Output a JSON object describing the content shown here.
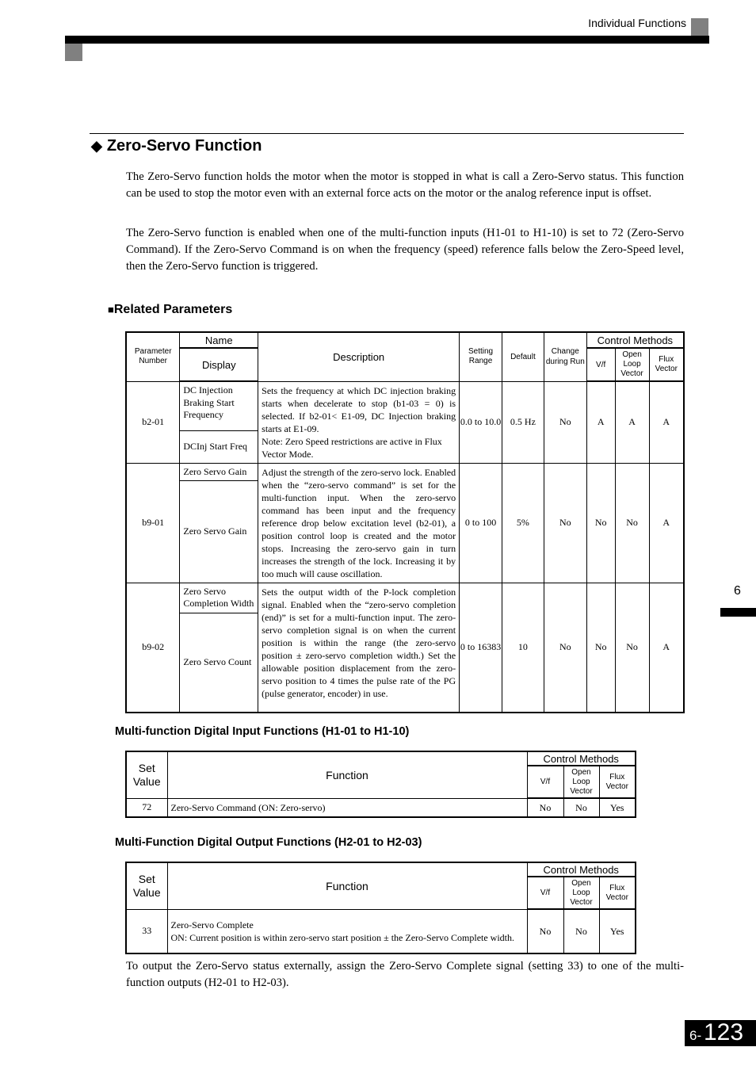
{
  "header": {
    "section": "Individual Functions"
  },
  "section": {
    "icon": "diamond-icon",
    "title": "Zero-Servo Function",
    "paragraphs": [
      "The Zero-Servo function holds the motor when the motor is stopped in what is call a Zero-Servo status. This function can be used to stop the motor even with an external force acts on the motor or the analog reference input is offset.",
      "The Zero-Servo function is enabled when one of the multi-function inputs (H1-01 to H1-10) is set to 72 (Zero-Servo Command). If the Zero-Servo Command is on when the frequency (speed) reference falls below the Zero-Speed level, then the Zero-Servo function is triggered."
    ]
  },
  "related": {
    "icon": "square-bullet-icon",
    "heading": "Related Parameters",
    "headers": {
      "param_number": "Parameter Number",
      "name": "Name",
      "display": "Display",
      "description": "Description",
      "setting_range": "Setting Range",
      "default": "Default",
      "change_during_run": "Change during Run",
      "control_methods": "Control Methods",
      "vf": "V/f",
      "olv": "Open Loop Vector",
      "flux": "Flux Vector"
    },
    "rows": [
      {
        "number": "b2-01",
        "name": "DC Injection Braking Start Frequency",
        "display": "DCInj Start Freq",
        "description": "Sets the frequency at which DC injection braking starts when decelerate to stop (b1-03 = 0) is selected. If b2-01< E1-09, DC Injection braking starts at E1-09.",
        "note_label": "Note:",
        "note": "Zero Speed restrictions are active in Flux Vector Mode.",
        "range": "0.0 to 10.0",
        "default": "0.5 Hz",
        "change": "No",
        "vf": "A",
        "olv": "A",
        "flux": "A"
      },
      {
        "number": "b9-01",
        "name": "Zero Servo Gain",
        "display": "Zero Servo Gain",
        "description": "Adjust the strength of the zero-servo lock. Enabled when the “zero-servo command” is set for the multi-function input. When the zero-servo command has been input and the frequency reference drop below excitation level (b2-01), a position control loop is created and the motor stops. Increasing the zero-servo gain in turn increases the strength of the lock. Increasing it by too much will cause oscillation.",
        "range": "0 to 100",
        "default": "5%",
        "change": "No",
        "vf": "No",
        "olv": "No",
        "flux": "A"
      },
      {
        "number": "b9-02",
        "name": "Zero Servo Completion Width",
        "display": "Zero Servo Count",
        "description": "Sets the output width of the P-lock completion signal. Enabled when the “zero-servo completion (end)” is set for a multi-function input. The zero-servo completion signal is on when the current position is within the range (the zero-servo position ± zero-servo completion width.) Set the allowable position displacement from the zero-servo position to 4 times the pulse rate of the PG (pulse generator, encoder) in use.",
        "range": "0 to 16383",
        "default": "10",
        "change": "No",
        "vf": "No",
        "olv": "No",
        "flux": "A"
      }
    ]
  },
  "inputs": {
    "heading": "Multi-function Digital Input Functions (H1-01 to H1-10)",
    "headers": {
      "set_value": "Set Value",
      "function": "Function",
      "control_methods": "Control Methods",
      "vf": "V/f",
      "olv": "Open Loop Vector",
      "flux": "Flux Vector"
    },
    "rows": [
      {
        "value": "72",
        "function": "Zero-Servo Command (ON: Zero-servo)",
        "vf": "No",
        "olv": "No",
        "flux": "Yes"
      }
    ]
  },
  "outputs": {
    "heading": "Multi-Function Digital Output Functions (H2-01 to H2-03)",
    "headers": {
      "set_value": "Set Value",
      "function": "Function",
      "control_methods": "Control Methods",
      "vf": "V/f",
      "olv": "Open Loop Vector",
      "flux": "Flux Vector"
    },
    "rows": [
      {
        "value": "33",
        "function_title": "Zero-Servo Complete",
        "function": "ON: Current position is within zero-servo start position ± the Zero-Servo Complete width.",
        "vf": "No",
        "olv": "No",
        "flux": "Yes"
      }
    ]
  },
  "closing": "To output the Zero-Servo status externally, assign the Zero-Servo Complete signal (setting 33) to one of the multi-function outputs (H2-01 to H2-03).",
  "chapter_tab": "6",
  "page": {
    "chapter": "6-",
    "number": "123"
  }
}
